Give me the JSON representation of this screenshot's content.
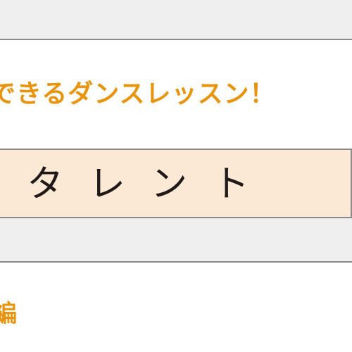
{
  "headline": "できるダンスレッスン！",
  "talent_label": "タレント",
  "bottom_fragment": "編",
  "colors": {
    "band_gray": "#efefef",
    "divider": "#8a8a8a",
    "talent_bg": "#fbe9d6",
    "accent_orange": "#e8940f",
    "text_dark": "#1f1a17"
  }
}
